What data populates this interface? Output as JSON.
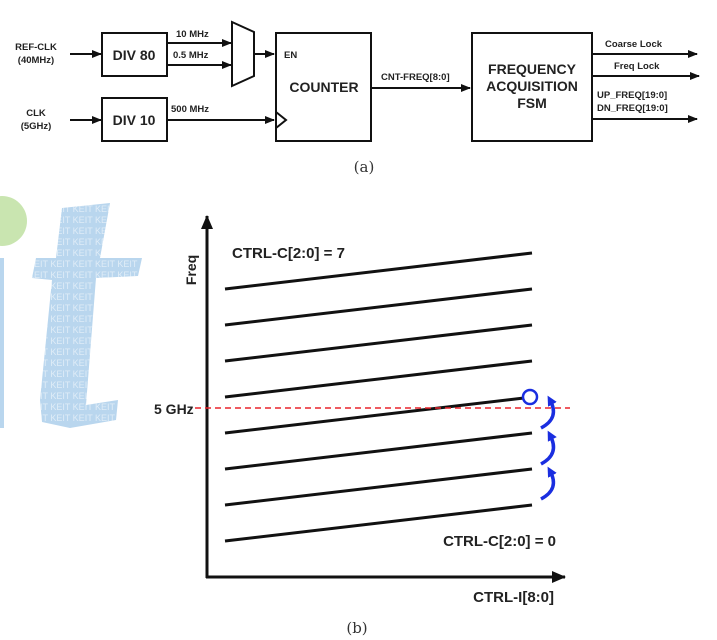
{
  "watermark": {
    "logo_text": "it",
    "pattern_text": "KEIT",
    "colors": {
      "green": "#c9e5b0",
      "blue": "#b9d6ee"
    }
  },
  "figure_a": {
    "inputs": {
      "ref_clk": "REF-CLK",
      "ref_clk_freq": "(40MHz)",
      "clk": "CLK",
      "clk_freq": "(5GHz)"
    },
    "blocks": {
      "div80": "DIV 80",
      "div10": "DIV 10",
      "counter": "COUNTER",
      "counter_en": "EN",
      "fsm_line1": "FREQUENCY",
      "fsm_line2": "ACQUISITION",
      "fsm_line3": "FSM"
    },
    "signals": {
      "f10": "10 MHz",
      "f05": "0.5 MHz",
      "f500": "500 MHz",
      "cnt": "CNT-FREQ[8:0]",
      "coarse": "Coarse Lock",
      "freq_lock": "Freq Lock",
      "up": "UP_FREQ[19:0]",
      "dn": "DN_FREQ[19:0]"
    },
    "caption": "(a)"
  },
  "figure_b": {
    "y_axis_label": "Freq",
    "x_axis_label": "CTRL-I[8:0]",
    "top_curve_label": "CTRL-C[2:0] = 7",
    "bottom_curve_label": "CTRL-C[2:0] = 0",
    "ref_line_label": "5 GHz",
    "curve_count": 8,
    "colors": {
      "ref_line": "#e8242c",
      "marker": "#1a2ee0"
    },
    "caption": "(b)"
  }
}
